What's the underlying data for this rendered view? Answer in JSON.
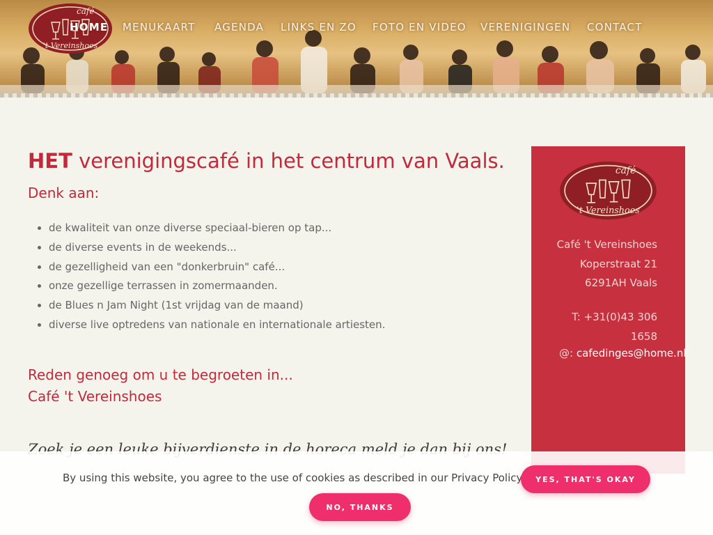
{
  "brand": {
    "logo_line1": "café",
    "logo_line2": "'t Vereinshoes",
    "accent": "#c22a3c",
    "sidebar_bg": "#c7303e",
    "button_bg": "#ee2f6b"
  },
  "nav": {
    "items": [
      "HOME",
      "MENUKAART",
      "AGENDA",
      "LINKS EN ZO",
      "FOTO EN VIDEO",
      "VERENIGINGEN",
      "CONTACT"
    ],
    "active": "HOME"
  },
  "main": {
    "headline_bold": "HET",
    "headline_rest": " verenigingscafé in het centrum van Vaals.",
    "subheading": "Denk aan:",
    "list": [
      "de kwaliteit van onze diverse speciaal-bieren op tap...",
      "de diverse events in de weekends...",
      "de gezelligheid van een \"donkerbruin\" café...",
      "onze gezellige terrassen in zomermaanden.",
      "de Blues n Jam Night  (1st vrijdag van de maand)",
      "diverse live optredens van nationale en internationale artiesten."
    ],
    "reden_line1": "Reden genoeg om u te begroeten in...",
    "reden_line2": "Café 't Vereinshoes",
    "zoek": "Zoek je een leuke bijverdienste in de horeca meld je dan bij ons!"
  },
  "sidebar": {
    "name": "Café 't Vereinshoes",
    "street": "Koperstraat 21",
    "city": "6291AH Vaals",
    "phone": "T: +31(0)43 306 1658",
    "email_prefix": "@: ",
    "email": "cafedinges@home.nl"
  },
  "cookie": {
    "text": "By using this website, you agree to the use of cookies as described in our Privacy Policy.",
    "accept": "YES, THAT'S OKAY",
    "decline": "NO, THANKS"
  }
}
